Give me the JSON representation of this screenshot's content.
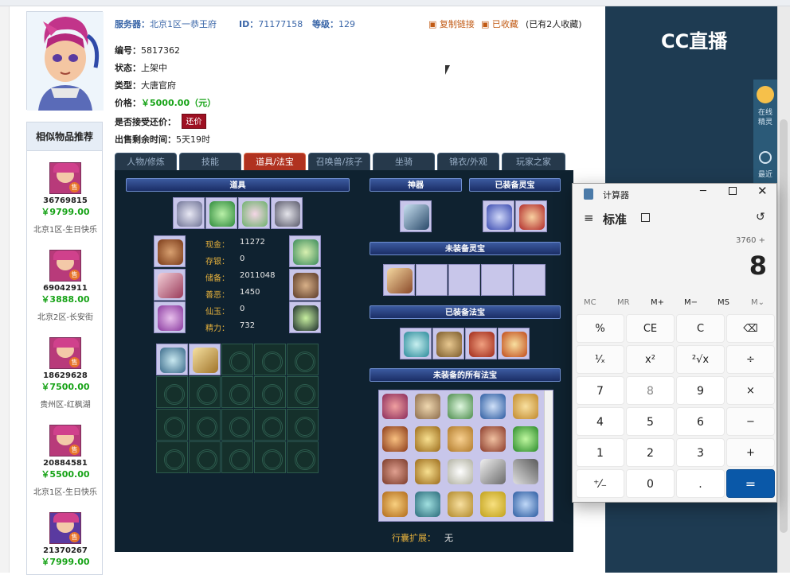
{
  "listing": {
    "server_label": "服务器：",
    "server_value": "北京1区一恭王府",
    "id_label": "ID：",
    "id_value": "71177158",
    "level_label": "等级：",
    "level_value": "129",
    "copy_link": "复制链接",
    "favorited": "已收藏",
    "fav_count": "(已有2人收藏)",
    "code_label": "编号：",
    "code_value": "5817362",
    "status_label": "状态：",
    "status_value": "上架中",
    "type_label": "类型：",
    "type_value": "大唐官府",
    "price_label": "价格：",
    "price_value": "￥5000.00（元）",
    "counter_label": "是否接受还价：",
    "counter_button": "还价",
    "remain_label": "出售剩余时间：",
    "remain_value": "5天19时"
  },
  "similar": {
    "title": "相似物品推荐",
    "tag": "售",
    "items": [
      {
        "id": "36769815",
        "price": "￥9799.00",
        "server": "北京1区-生日快乐"
      },
      {
        "id": "69042911",
        "price": "￥3888.00",
        "server": "北京2区-长安街"
      },
      {
        "id": "18629628",
        "price": "￥7500.00",
        "server": "贵州区-红枫湖"
      },
      {
        "id": "20884581",
        "price": "￥5500.00",
        "server": "北京1区-生日快乐"
      },
      {
        "id": "21370267",
        "price": "￥7999.00",
        "server": ""
      }
    ]
  },
  "tabs": [
    "人物/修炼",
    "技能",
    "道具/法宝",
    "召唤兽/孩子",
    "坐骑",
    "锦衣/外观",
    "玩家之家"
  ],
  "active_tab": 2,
  "game": {
    "items_header": "道具",
    "artifact_header": "神器",
    "equipped_spirit_header": "已装备灵宝",
    "unequipped_spirit_header": "未装备灵宝",
    "equipped_magic_header": "已装备法宝",
    "unequipped_all_header": "未装备的所有法宝",
    "stats": [
      {
        "label": "现金：",
        "value": "11272"
      },
      {
        "label": "存银：",
        "value": "0"
      },
      {
        "label": "储备：",
        "value": "2011048"
      },
      {
        "label": "善恶：",
        "value": "1450"
      },
      {
        "label": "仙玉：",
        "value": "0"
      },
      {
        "label": "精力：",
        "value": "732"
      }
    ],
    "bag_expand_label": "行囊扩展：",
    "bag_expand_value": "无"
  },
  "cc": {
    "logo": "CC直播",
    "side1": "在线\n精灵",
    "side2": "最近"
  },
  "calculator": {
    "title": "计算器",
    "mode": "标准",
    "expression": "3760 +",
    "display": "8",
    "memory": [
      "MC",
      "MR",
      "M+",
      "M−",
      "MS",
      "M⌄"
    ],
    "keys": [
      "%",
      "CE",
      "C",
      "⌫",
      "¹⁄ₓ",
      "x²",
      "²√x",
      "÷",
      "7",
      "8",
      "9",
      "×",
      "4",
      "5",
      "6",
      "−",
      "1",
      "2",
      "3",
      "+",
      "⁺⁄₋",
      "0",
      ".",
      "="
    ]
  }
}
